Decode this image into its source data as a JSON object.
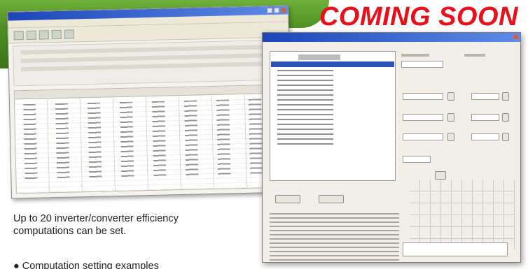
{
  "banner": {
    "headline": "COMING SOON",
    "headline_color": "#e8101b",
    "accent_color": "#5a9a2a"
  },
  "caption": {
    "line1": "Up to 20 inverter/converter efficiency",
    "line2": "computations can be set."
  },
  "bullet": {
    "text": "● Computation setting examples"
  },
  "screenshots": [
    {
      "name": "efficiency-results-table-window"
    },
    {
      "name": "computation-settings-dialog-window"
    }
  ]
}
